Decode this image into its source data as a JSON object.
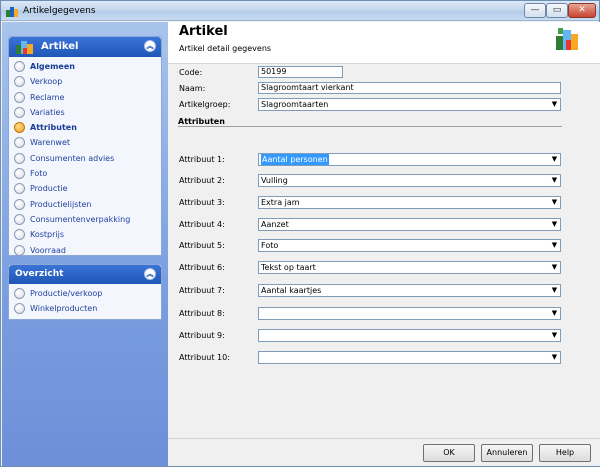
{
  "window": {
    "title": "Artikelgegevens",
    "min_glyph": "—",
    "max_glyph": "▭",
    "close_glyph": "✕"
  },
  "sidebar": {
    "panels": [
      {
        "title": "Artikel",
        "collapse_glyph": "︽",
        "items": [
          {
            "label": "Algemeen",
            "bold": true,
            "active": false
          },
          {
            "label": "Verkoop",
            "bold": false,
            "active": false
          },
          {
            "label": "Reclame",
            "bold": false,
            "active": false
          },
          {
            "label": "Variaties",
            "bold": false,
            "active": false
          },
          {
            "label": "Attributen",
            "bold": true,
            "active": true
          },
          {
            "label": "Warenwet",
            "bold": false,
            "active": false
          },
          {
            "label": "Consumenten advies",
            "bold": false,
            "active": false
          },
          {
            "label": "Foto",
            "bold": false,
            "active": false
          },
          {
            "label": "Productie",
            "bold": false,
            "active": false
          },
          {
            "label": "Productielijsten",
            "bold": false,
            "active": false
          },
          {
            "label": "Consumentenverpakking",
            "bold": false,
            "active": false
          },
          {
            "label": "Kostprijs",
            "bold": false,
            "active": false
          },
          {
            "label": "Voorraad",
            "bold": false,
            "active": false
          }
        ]
      },
      {
        "title": "Overzicht",
        "collapse_glyph": "︽",
        "items": [
          {
            "label": "Productie/verkoop"
          },
          {
            "label": "Winkelproducten"
          }
        ]
      }
    ]
  },
  "header": {
    "title": "Artikel",
    "subtitle": "Artikel detail gegevens"
  },
  "form": {
    "code_label": "Code:",
    "code_value": "50199",
    "naam_label": "Naam:",
    "naam_value": "Slagroomtaart vierkant",
    "artikelgroep_label": "Artikelgroep:",
    "artikelgroep_value": "Slagroomtaarten",
    "section_title": "Attributen",
    "combo_arrow": "▼",
    "attributes": [
      {
        "label": "Attribuut 1:",
        "value": "Aantal personen"
      },
      {
        "label": "Attribuut 2:",
        "value": "Vulling"
      },
      {
        "label": "Attribuut 3:",
        "value": "Extra jam"
      },
      {
        "label": "Attribuut 4:",
        "value": "Aanzet"
      },
      {
        "label": "Attribuut 5:",
        "value": "Foto"
      },
      {
        "label": "Attribuut 6:",
        "value": "Tekst op taart"
      },
      {
        "label": "Attribuut 7:",
        "value": "Aantal kaartjes"
      },
      {
        "label": "Attribuut 8:",
        "value": ""
      },
      {
        "label": "Attribuut 9:",
        "value": ""
      },
      {
        "label": "Attribuut 10:",
        "value": ""
      }
    ]
  },
  "footer": {
    "ok_label": "OK",
    "cancel_label": "Annuleren",
    "help_label": "Help"
  },
  "colors": {
    "accent": "#1f56b8",
    "selection": "#3399ff",
    "link": "#1f3f9e"
  }
}
